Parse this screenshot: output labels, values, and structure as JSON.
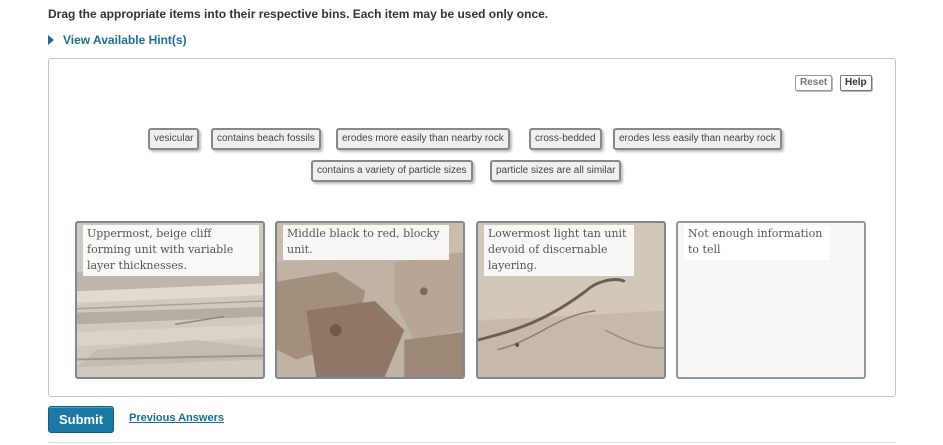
{
  "instructions": "Drag the appropriate items into their respective bins. Each item may be used only once.",
  "hint_link": "View Available Hint(s)",
  "toolbar": {
    "reset_label": "Reset",
    "help_label": "Help"
  },
  "items": [
    "vesicular",
    "contains beach fossils",
    "erodes more easily than nearby rock",
    "cross-bedded",
    "erodes less easily than nearby rock",
    "contains a variety of particle sizes",
    "particle sizes are all similar"
  ],
  "bins": [
    "Uppermost,  beige cliff forming unit with variable layer thicknesses.",
    "Middle black to red,  blocky unit.",
    "Lowermost light tan unit devoid of discernable layering.",
    "Not enough information to tell"
  ],
  "footer": {
    "submit_label": "Submit",
    "previous_answers_label": "Previous Answers"
  },
  "colors": {
    "link": "#1a6f92",
    "submit_bg": "#1b79a6",
    "chip_border": "#888888"
  }
}
